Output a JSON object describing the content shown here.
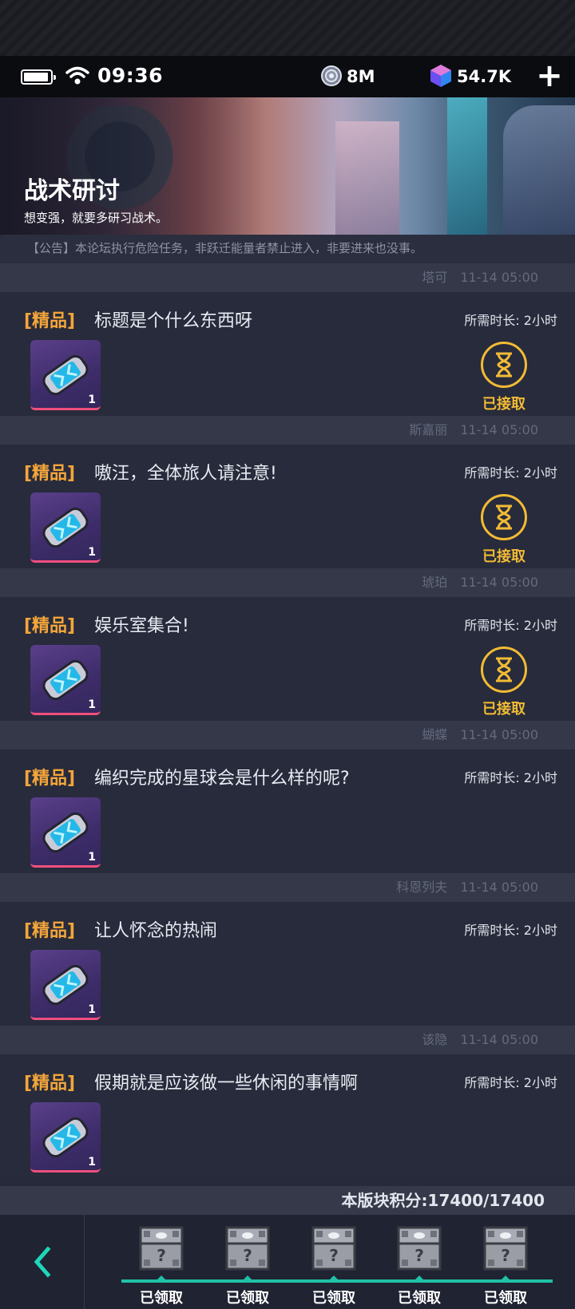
{
  "status_bar": {
    "time": "09:36",
    "coins": "8M",
    "gems": "54.7K",
    "plus_icon": "plus-icon"
  },
  "banner": {
    "title": "战术研讨",
    "subtitle": "想变强，就要多研习战术。"
  },
  "notice": "【公告】本论坛执行危险任务，非跃迁能量者禁止进入，非要进来也没事。",
  "posts": [
    {
      "author": "塔可",
      "time": "11-14 05:00",
      "tag": "[精品]",
      "title": "标题是个什么东西呀",
      "duration": "所需时长: 2小时",
      "item_count": "1",
      "accepted": true,
      "accepted_label": "已接取"
    },
    {
      "author": "斯嘉丽",
      "time": "11-14 05:00",
      "tag": "[精品]",
      "title": "嗷汪，全体旅人请注意!",
      "duration": "所需时长: 2小时",
      "item_count": "1",
      "accepted": true,
      "accepted_label": "已接取"
    },
    {
      "author": "琥珀",
      "time": "11-14 05:00",
      "tag": "[精品]",
      "title": "娱乐室集合!",
      "duration": "所需时长: 2小时",
      "item_count": "1",
      "accepted": true,
      "accepted_label": "已接取"
    },
    {
      "author": "蝴蝶",
      "time": "11-14 05:00",
      "tag": "[精品]",
      "title": "编织完成的星球会是什么样的呢?",
      "duration": "所需时长: 2小时",
      "item_count": "1",
      "accepted": false,
      "accepted_label": ""
    },
    {
      "author": "科恩列夫",
      "time": "11-14 05:00",
      "tag": "[精品]",
      "title": "让人怀念的热闹",
      "duration": "所需时长: 2小时",
      "item_count": "1",
      "accepted": false,
      "accepted_label": ""
    },
    {
      "author": "该隐",
      "time": "11-14 05:00",
      "tag": "[精品]",
      "title": "假期就是应该做一些休闲的事情啊",
      "duration": "所需时长: 2小时",
      "item_count": "1",
      "accepted": false,
      "accepted_label": ""
    }
  ],
  "score": "本版块积分:17400/17400",
  "rewards": [
    {
      "label": "已领取"
    },
    {
      "label": "已领取"
    },
    {
      "label": "已领取"
    },
    {
      "label": "已领取"
    },
    {
      "label": "已领取"
    }
  ],
  "colors": {
    "tag": "#f4a53a",
    "accepted": "#f2bb35",
    "track": "#1fc2a6",
    "back_arrow": "#1fd6b8"
  }
}
